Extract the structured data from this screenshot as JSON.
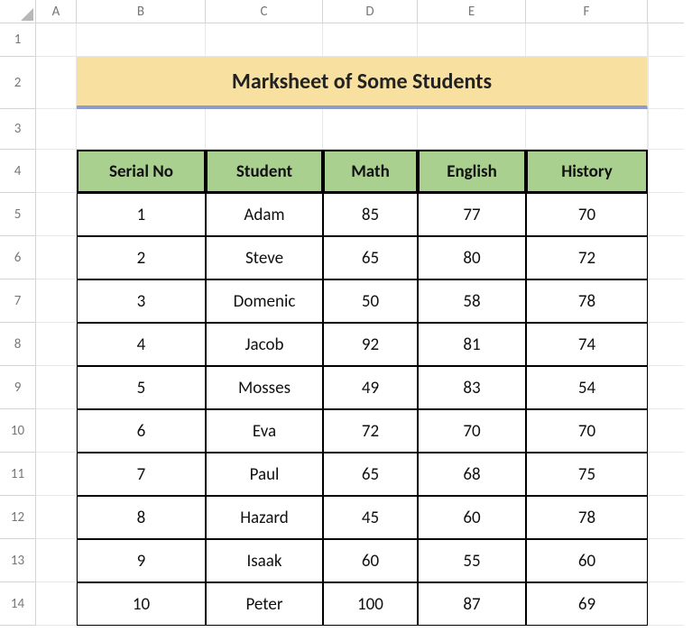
{
  "columns": [
    "A",
    "B",
    "C",
    "D",
    "E",
    "F"
  ],
  "rows": [
    "1",
    "2",
    "3",
    "4",
    "5",
    "6",
    "7",
    "8",
    "9",
    "10",
    "11",
    "12",
    "13",
    "14"
  ],
  "title": "Marksheet of Some Students",
  "table": {
    "headers": [
      "Serial No",
      "Student",
      "Math",
      "English",
      "History"
    ],
    "data": [
      [
        "1",
        "Adam",
        "85",
        "77",
        "70"
      ],
      [
        "2",
        "Steve",
        "65",
        "80",
        "72"
      ],
      [
        "3",
        "Domenic",
        "50",
        "58",
        "78"
      ],
      [
        "4",
        "Jacob",
        "92",
        "81",
        "74"
      ],
      [
        "5",
        "Mosses",
        "49",
        "83",
        "54"
      ],
      [
        "6",
        "Eva",
        "72",
        "70",
        "70"
      ],
      [
        "7",
        "Paul",
        "65",
        "68",
        "75"
      ],
      [
        "8",
        "Hazard",
        "45",
        "60",
        "78"
      ],
      [
        "9",
        "Isaak",
        "60",
        "55",
        "60"
      ],
      [
        "10",
        "Peter",
        "100",
        "87",
        "69"
      ]
    ]
  }
}
